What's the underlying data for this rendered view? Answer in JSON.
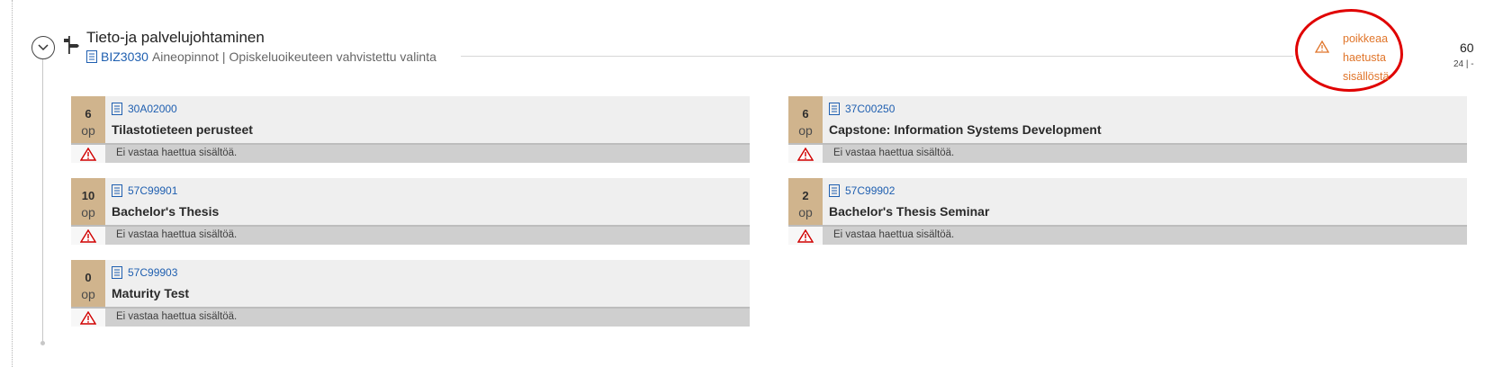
{
  "module": {
    "title": "Tieto-ja palvelujohtaminen",
    "code": "BIZ3030",
    "type": "Aineopinnot",
    "separator": "|",
    "status": "Opiskeluoikeuteen vahvistettu valinta",
    "warning_lines": [
      "poikkeaa",
      "haetusta",
      "sisällöstä"
    ],
    "credits_total": "60",
    "credits_sub": "24 | -"
  },
  "colors": {
    "credit_box": "#d0b48d",
    "warning": "#e0752a",
    "link": "#1f5fb0",
    "highlight": "#e00000"
  },
  "icons": {
    "toggle": "chevron-down-icon",
    "module": "signpost-icon",
    "document": "document-icon",
    "warning": "warning-triangle-icon"
  },
  "courses": [
    {
      "credits": "6",
      "unit": "op",
      "code": "30A02000",
      "name": "Tilastotieteen perusteet",
      "warning": "Ei vastaa haettua sisältöä."
    },
    {
      "credits": "6",
      "unit": "op",
      "code": "37C00250",
      "name": "Capstone: Information Systems Development",
      "warning": "Ei vastaa haettua sisältöä."
    },
    {
      "credits": "10",
      "unit": "op",
      "code": "57C99901",
      "name": "Bachelor's Thesis",
      "warning": "Ei vastaa haettua sisältöä."
    },
    {
      "credits": "2",
      "unit": "op",
      "code": "57C99902",
      "name": "Bachelor's Thesis Seminar",
      "warning": "Ei vastaa haettua sisältöä."
    },
    {
      "credits": "0",
      "unit": "op",
      "code": "57C99903",
      "name": "Maturity Test",
      "warning": "Ei vastaa haettua sisältöä."
    }
  ]
}
